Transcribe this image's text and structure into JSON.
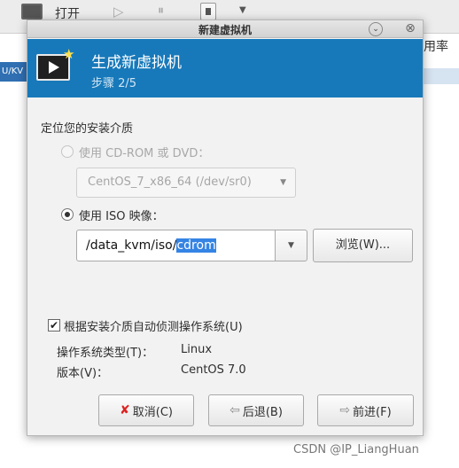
{
  "background": {
    "toolbar": {
      "open_label": "打开"
    },
    "right_text": "用率",
    "left_strip_text": "U/KV"
  },
  "dialog": {
    "title": "新建虚拟机",
    "heading": "生成新虚拟机",
    "step": "步骤 2/5",
    "section_label": "定位您的安装介质",
    "option_cdrom": {
      "label": "使用 CD-ROM 或 DVD：",
      "enabled": false,
      "checked": false
    },
    "cdrom_combo": {
      "value": "CentOS_7_x86_64 (/dev/sr0)",
      "enabled": false
    },
    "option_iso": {
      "label": "使用 ISO 映像：",
      "enabled": true,
      "checked": true
    },
    "iso_path": {
      "value_prefix": "/data_kvm/iso/",
      "value_selected": "cdrom"
    },
    "browse_label": "浏览(W)...",
    "autodetect": {
      "label": "根据安装介质自动侦测操作系统(U)",
      "checked": true
    },
    "os_type": {
      "key": "操作系统类型(T)：",
      "value": "Linux"
    },
    "os_version": {
      "key": "版本(V)：",
      "value": "CentOS 7.0"
    },
    "buttons": {
      "cancel": "取消(C)",
      "back": "后退(B)",
      "forward": "前进(F)"
    }
  },
  "watermark": "CSDN @IP_LiangHuan",
  "colors": {
    "banner": "#1779ba",
    "selection": "#3584e4"
  },
  "icons": [
    "monitor-icon",
    "play-icon",
    "pause-icon",
    "stop-icon",
    "vm-screen-icon",
    "star-icon",
    "minimize-icon",
    "close-icon",
    "chevron-down-icon",
    "cancel-icon",
    "back-arrow-icon",
    "forward-arrow-icon"
  ]
}
